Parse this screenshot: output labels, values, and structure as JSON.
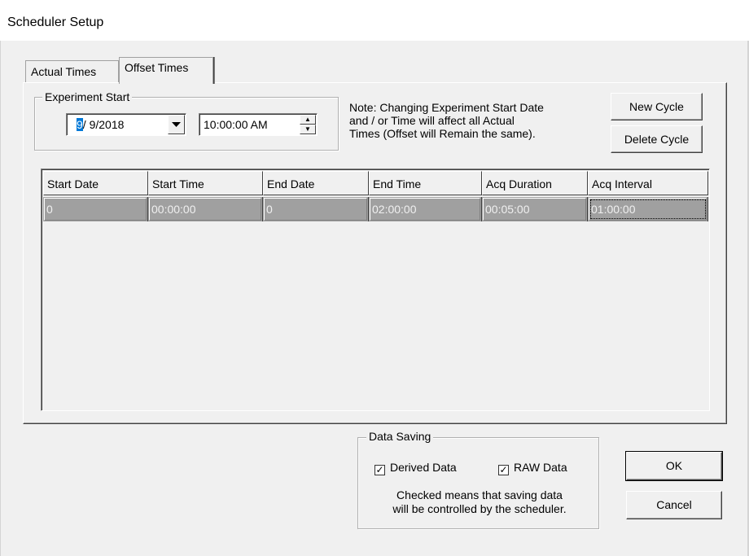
{
  "window": {
    "title": "Scheduler Setup"
  },
  "tabs": [
    {
      "label": "Actual Times",
      "active": false
    },
    {
      "label": "Offset Times",
      "active": true
    }
  ],
  "experiment_start": {
    "group_label": "Experiment Start",
    "date_month": "9",
    "date_rest": "/ 9/2018",
    "time_value": "10:00:00 AM"
  },
  "note": {
    "lines": [
      "Note: Changing Experiment Start Date",
      "and / or Time will affect all Actual",
      "Times (Offset will Remain the same)."
    ]
  },
  "buttons": {
    "new_cycle": "New Cycle",
    "delete_cycle": "Delete Cycle",
    "ok": "OK",
    "cancel": "Cancel"
  },
  "grid": {
    "columns": [
      "Start Date",
      "Start Time",
      "End Date",
      "End Time",
      "Acq Duration",
      "Acq Interval"
    ],
    "rows": [
      [
        "0",
        "00:00:00",
        "0",
        "02:00:00",
        "00:05:00",
        "01:00:00"
      ]
    ]
  },
  "data_saving": {
    "group_label": "Data Saving",
    "derived_label": "Derived Data",
    "derived_checked": true,
    "raw_label": "RAW Data",
    "raw_checked": true,
    "note_line1": "Checked means that saving data",
    "note_line2": "will be controlled by the scheduler."
  }
}
